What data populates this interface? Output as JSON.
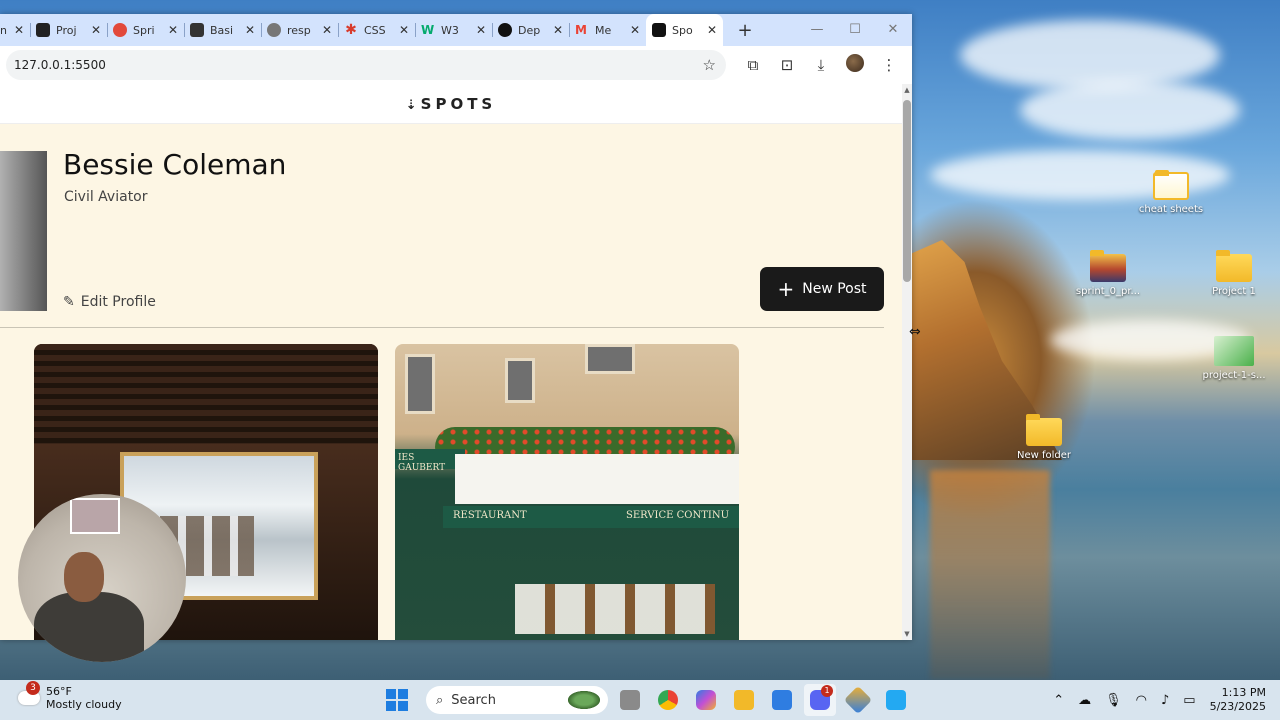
{
  "browser": {
    "tabs": [
      {
        "label": "n",
        "color": "#888888"
      },
      {
        "label": "Proj",
        "color": "#222222"
      },
      {
        "label": "Spri",
        "color": "#e2493b"
      },
      {
        "label": "Basi",
        "color": "#333333"
      },
      {
        "label": "resp",
        "color": "#555555"
      },
      {
        "label": "CSS",
        "color": "#d83b2c"
      },
      {
        "label": "W3",
        "color": "#04aa6d"
      },
      {
        "label": "Dep",
        "color": "#111111"
      },
      {
        "label": "Me",
        "color": "#ea4335"
      },
      {
        "label": "Spo",
        "color": "#111111"
      }
    ],
    "address": "127.0.0.1:5500"
  },
  "site": {
    "logo": "SPOTS",
    "profile": {
      "name": "Bessie Coleman",
      "job": "Civil Aviator",
      "edit_label": "Edit Profile",
      "new_post_label": "New Post"
    },
    "cards": {
      "card2_sign_left": "RESTAURANT",
      "card2_sign_right": "SERVICE CONTINU",
      "card2_shop": "IES GAUBERT"
    }
  },
  "desktop": {
    "icons": [
      {
        "label": "cheat sheets"
      },
      {
        "label": "sprint_0_pr..."
      },
      {
        "label": "Project 1"
      },
      {
        "label": "project-1-s..."
      },
      {
        "label": "New folder"
      }
    ]
  },
  "taskbar": {
    "weather_temp": "56°F",
    "weather_desc": "Mostly cloudy",
    "weather_badge": "3",
    "search_placeholder": "Search",
    "discord_badge": "1",
    "time": "1:13 PM",
    "date": "5/23/2025"
  }
}
